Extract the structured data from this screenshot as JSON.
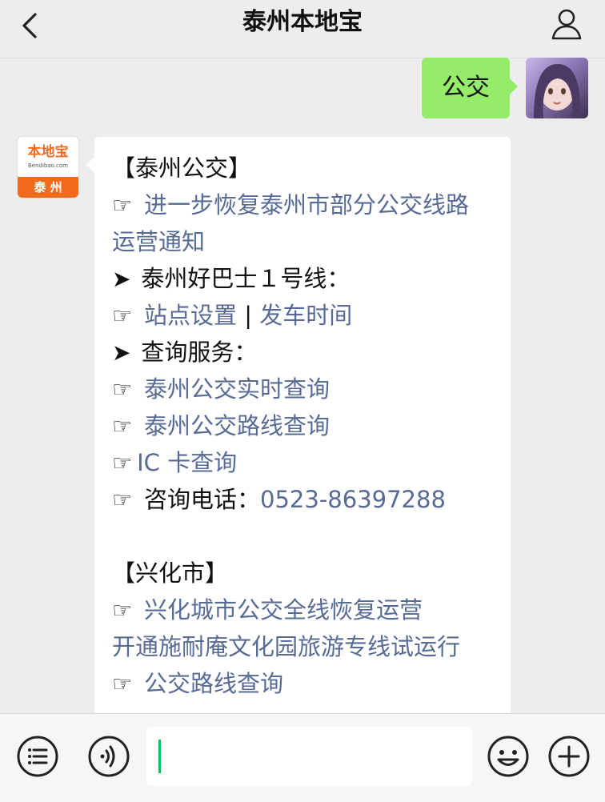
{
  "header": {
    "title": "泰州本地宝",
    "back_icon": "chevron-left-icon",
    "profile_icon": "user-icon"
  },
  "chat": {
    "user_message": "公交",
    "bot_avatar": {
      "brand": "本地宝",
      "domain": "Bendibao.com",
      "city": "泰 州"
    },
    "reply_lines": [
      [
        {
          "text": "【泰州公交】",
          "type": "plain"
        }
      ],
      [
        {
          "text": "☞ ",
          "type": "hand"
        },
        {
          "text": "进一步恢复泰州市部分公交线路",
          "type": "link"
        }
      ],
      [
        {
          "text": "运营通知",
          "type": "link"
        }
      ],
      [
        {
          "text": "➤ ",
          "type": "arrow"
        },
        {
          "text": "泰州好巴士１号线：",
          "type": "plain"
        }
      ],
      [
        {
          "text": "☞ ",
          "type": "hand"
        },
        {
          "text": "站点设置",
          "type": "link"
        },
        {
          "text": " | ",
          "type": "plain"
        },
        {
          "text": "发车时间",
          "type": "link"
        }
      ],
      [
        {
          "text": "➤ ",
          "type": "arrow"
        },
        {
          "text": "查询服务：",
          "type": "plain"
        }
      ],
      [
        {
          "text": "☞ ",
          "type": "hand"
        },
        {
          "text": "泰州公交实时查询",
          "type": "link"
        }
      ],
      [
        {
          "text": "☞ ",
          "type": "hand"
        },
        {
          "text": "泰州公交路线查询",
          "type": "link"
        }
      ],
      [
        {
          "text": "☞",
          "type": "hand"
        },
        {
          "text": "IC 卡查询",
          "type": "link"
        }
      ],
      [
        {
          "text": "☞ ",
          "type": "hand"
        },
        {
          "text": "咨询电话：",
          "type": "plain"
        },
        {
          "text": "0523-86397288",
          "type": "link"
        }
      ],
      [
        {
          "text": "",
          "type": "plain"
        }
      ],
      [
        {
          "text": "【兴化市】",
          "type": "plain"
        }
      ],
      [
        {
          "text": "☞ ",
          "type": "hand"
        },
        {
          "text": "兴化城市公交全线恢复运营",
          "type": "link"
        }
      ],
      [
        {
          "text": "开通施耐庵文化园旅游专线试运行",
          "type": "link"
        }
      ],
      [
        {
          "text": "☞ ",
          "type": "hand"
        },
        {
          "text": "公交路线查询",
          "type": "link"
        }
      ]
    ]
  },
  "input_bar": {
    "menu_icon": "menu-list-icon",
    "voice_icon": "voice-icon",
    "text_value": "",
    "emoji_icon": "emoji-icon",
    "plus_icon": "plus-icon"
  },
  "colors": {
    "background": "#ededed",
    "user_bubble": "#95ec69",
    "link": "#576b95",
    "caret": "#07c160",
    "brand_orange": "#f26b1d"
  }
}
